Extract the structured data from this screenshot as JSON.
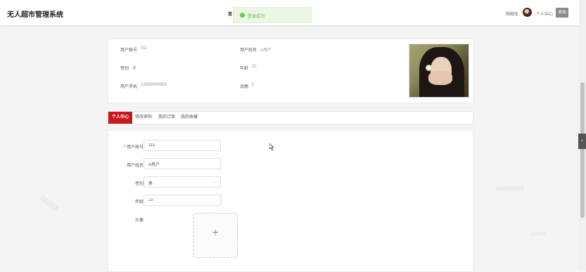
{
  "header": {
    "brand": "无人超市管理系统",
    "center_mark": "首",
    "cart": "购物车",
    "personal_center": "个人中心",
    "logout": "退出"
  },
  "toast": {
    "icon": "✓",
    "message": "登录成功"
  },
  "profile": {
    "account_label": "用户账号",
    "account_value": "111",
    "name_label": "用户姓名",
    "name_value": "A用户",
    "gender_label": "性别",
    "gender_value": "男",
    "age_label": "年龄",
    "age_value": "22",
    "phone_label": "用户手机",
    "phone_value": "13899999999",
    "balance_label": "余额",
    "balance_value": "0"
  },
  "tabs": [
    "个人中心",
    "修改密码",
    "我的订单",
    "我的收藏"
  ],
  "form": {
    "required_mark": "*",
    "account_label": "用户账号",
    "account_value": "111",
    "name_label": "用户姓名",
    "name_value": "A用户",
    "gender_label": "性别",
    "gender_value": "男",
    "age_label": "年龄",
    "age_value": "22",
    "avatar_label": "头像",
    "upload_icon": "+"
  },
  "misc": {
    "side_tab_icon": "‹",
    "select_chevron_icon": "⌄"
  },
  "colors": {
    "accent": "#c9171e",
    "success": "#67c23a"
  }
}
